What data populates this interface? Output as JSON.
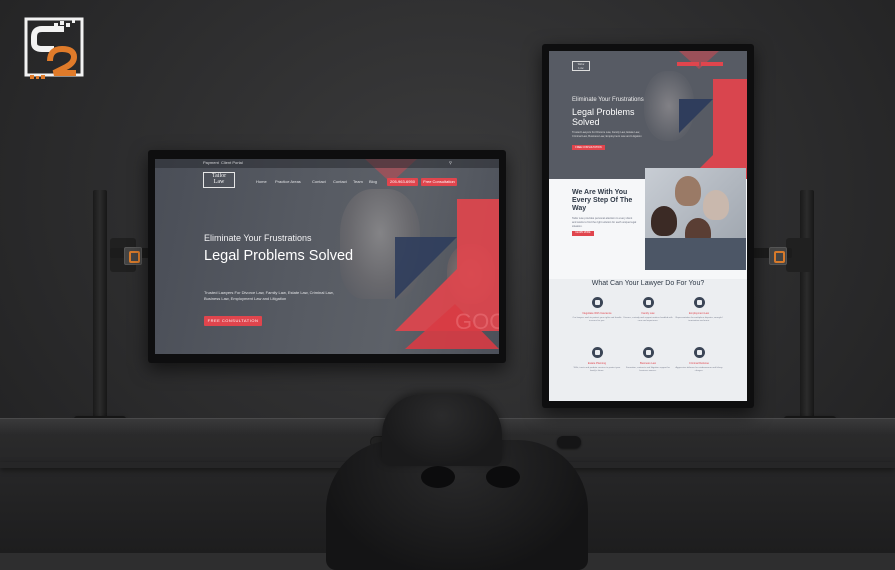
{
  "colors": {
    "accent_red": "#e0454d",
    "navy_triangle": "#2f3d5c",
    "brand_orange": "#e07b2a",
    "room_dark": "#2e2e2f"
  },
  "brand_logo": {
    "icon": "s2-brand-logo-icon"
  },
  "left_site": {
    "topbar": {
      "link1": "Payment",
      "link2": "Client Portal"
    },
    "logo": {
      "line1": "Tailor",
      "line2": "Law"
    },
    "nav": [
      "Home",
      "Practice Areas",
      "Contact",
      "Contact",
      "Team",
      "Blog"
    ],
    "phone_button": "205-963-6950",
    "consult_button": "Free Consultation",
    "hero": {
      "kicker": "Eliminate Your Frustrations",
      "title": "Legal Problems Solved",
      "text": "Trusted Lawyers For Divorce Law, Family Law, Estate Law, Criminal Law, Business Law, Employment Law and Litigation",
      "cta": "FREE CONSULTATION"
    }
  },
  "right_site": {
    "logo": {
      "line1": "Tailor",
      "line2": "Law"
    },
    "hero": {
      "kicker": "Eliminate Your Frustrations",
      "title": "Legal Problems Solved",
      "text": "Trusted Lawyers For Divorce Law, Family Law, Estate Law, Criminal Law, Business Law, Employment Law and Litigation",
      "cta": "FREE CONSULTATION"
    },
    "section2": {
      "title": "We Are With You Every Step Of The Way",
      "text": "Tailor Law provides personal attention to every client and works to find the right solution for each unique legal situation.",
      "cta": "LEARN MORE"
    },
    "section3": {
      "title": "What Can Your Lawyer Do For You?",
      "services": [
        {
          "title": "Negotiate With Insurance",
          "text": "Our lawyers work to protect your rights and handle insurers for you.",
          "icon": "chat-icon"
        },
        {
          "title": "Family Law",
          "text": "Divorce, custody and support matters handled with care and experience.",
          "icon": "scale-icon"
        },
        {
          "title": "Employment Law",
          "text": "Representation for workplace disputes, wrongful termination and more.",
          "icon": "people-icon"
        },
        {
          "title": "Estate Planning",
          "text": "Wills, trusts and probate services to protect your family's future.",
          "icon": "dollar-icon"
        },
        {
          "title": "Business Law",
          "text": "Formation, contracts and litigation support for business owners.",
          "icon": "calculator-icon"
        },
        {
          "title": "Criminal Defense",
          "text": "Aggressive defense for misdemeanor and felony charges.",
          "icon": "document-icon"
        }
      ]
    }
  }
}
